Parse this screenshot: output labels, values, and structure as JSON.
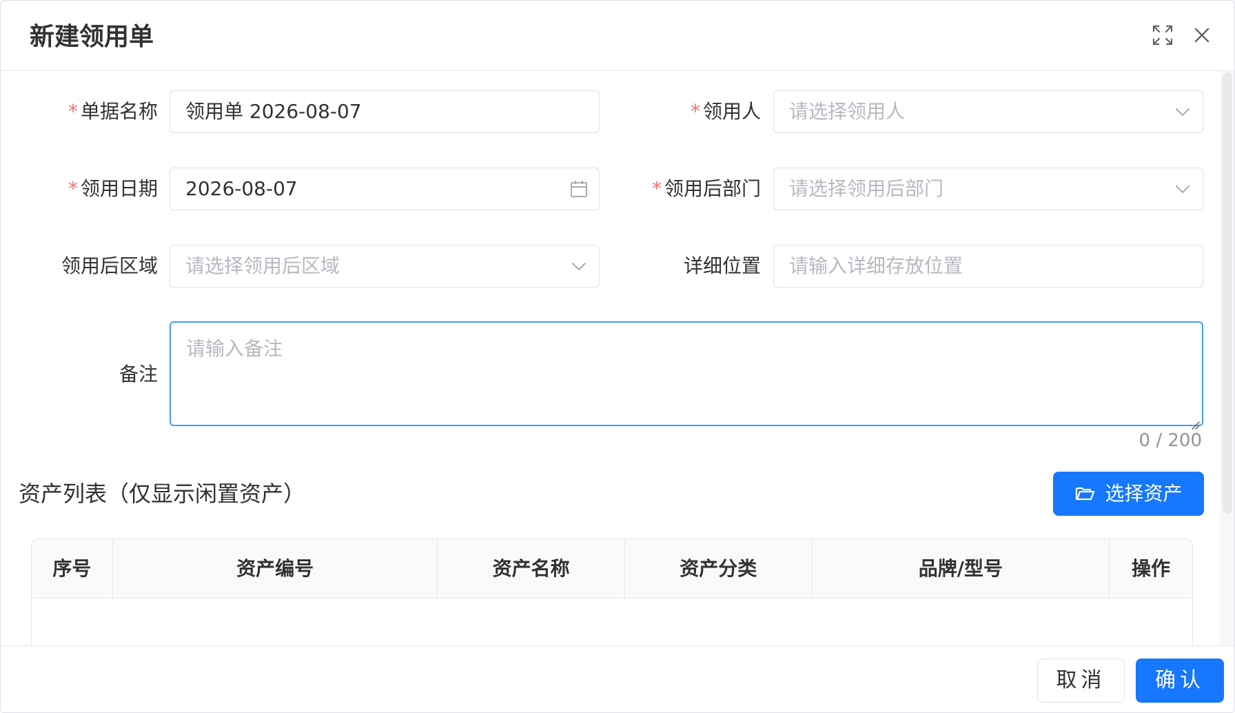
{
  "dialog": {
    "title": "新建领用单"
  },
  "form": {
    "doc_name": {
      "label": "单据名称",
      "required": "*",
      "value": "领用单 2026-08-07"
    },
    "recipient": {
      "label": "领用人",
      "required": "*",
      "placeholder": "请选择领用人"
    },
    "date": {
      "label": "领用日期",
      "required": "*",
      "value": "2026-08-07"
    },
    "department": {
      "label": "领用后部门",
      "required": "*",
      "placeholder": "请选择领用后部门"
    },
    "area": {
      "label": "领用后区域",
      "placeholder": "请选择领用后区域"
    },
    "location": {
      "label": "详细位置",
      "placeholder": "请输入详细存放位置"
    },
    "remark": {
      "label": "备注",
      "placeholder": "请输入备注",
      "counter": "0 / 200"
    }
  },
  "assets": {
    "section_title": "资产列表（仅显示闲置资产）",
    "select_button": "选择资产",
    "columns": [
      "序号",
      "资产编号",
      "资产名称",
      "资产分类",
      "品牌/型号",
      "操作"
    ],
    "rows": []
  },
  "footer": {
    "cancel": "取消",
    "confirm": "确认"
  },
  "colors": {
    "primary": "#1677ff",
    "required": "#f56c6c",
    "focus_border": "#409eff"
  },
  "icons": {
    "fullscreen": "fullscreen-icon",
    "close": "close-icon",
    "chevron": "chevron-down-icon",
    "calendar": "calendar-icon",
    "folder": "folder-open-icon"
  }
}
